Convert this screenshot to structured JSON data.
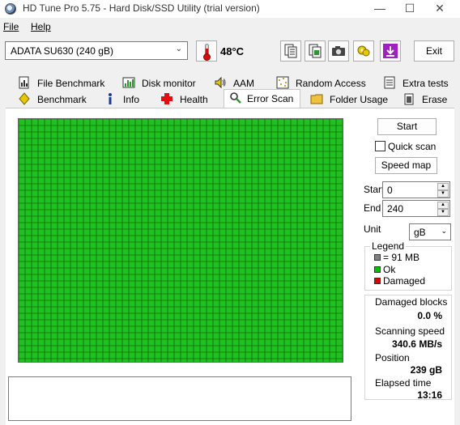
{
  "window": {
    "title": "HD Tune Pro 5.75 - Hard Disk/SSD Utility (trial version)",
    "min": "—",
    "max": "☐",
    "close": "✕"
  },
  "menu": [
    {
      "label": "File"
    },
    {
      "label": "Help"
    }
  ],
  "toolbar": {
    "drive": "ADATA SU630 (240 gB)",
    "temperature": "48°C",
    "exit_label": "Exit",
    "icons": [
      "copy-text-icon",
      "copy-screenshot-icon",
      "camera-icon",
      "options-icon",
      "save-icon"
    ]
  },
  "tabs_row1": [
    {
      "label": "File Benchmark",
      "icon": "file-benchmark-icon"
    },
    {
      "label": "Disk monitor",
      "icon": "disk-monitor-icon"
    },
    {
      "label": "AAM",
      "icon": "speaker-icon"
    },
    {
      "label": "Random Access",
      "icon": "random-access-icon"
    },
    {
      "label": "Extra tests",
      "icon": "extra-tests-icon"
    }
  ],
  "tabs_row2": [
    {
      "label": "Benchmark",
      "icon": "benchmark-icon"
    },
    {
      "label": "Info",
      "icon": "info-icon"
    },
    {
      "label": "Health",
      "icon": "health-cross-icon"
    },
    {
      "label": "Error Scan",
      "icon": "magnifier-icon",
      "active": true
    },
    {
      "label": "Folder Usage",
      "icon": "folder-icon"
    },
    {
      "label": "Erase",
      "icon": "erase-icon"
    }
  ],
  "scan": {
    "start_button": "Start",
    "quick_scan_label": "Quick scan",
    "quick_scan_checked": false,
    "speed_map_button": "Speed map",
    "start_label": "Start",
    "start_value": "0",
    "end_label": "End",
    "end_value": "240",
    "unit_label": "Unit",
    "unit_value": "gB"
  },
  "legend": {
    "title": "Legend",
    "items": [
      {
        "label": "= 91 MB",
        "color": "#808080"
      },
      {
        "label": "Ok",
        "color": "#00c000"
      },
      {
        "label": "Damaged",
        "color": "#e00000"
      }
    ]
  },
  "stats": {
    "damaged_label": "Damaged blocks",
    "damaged_value": "0.0 %",
    "speed_label": "Scanning speed",
    "speed_value": "340.6 MB/s",
    "position_label": "Position",
    "position_value": "239 gB",
    "elapsed_label": "Elapsed time",
    "elapsed_value": "13:16"
  },
  "block_map": {
    "ok_color": "#20c020",
    "cell_border_color": "#0a4a0a",
    "status": "all blocks ok"
  }
}
